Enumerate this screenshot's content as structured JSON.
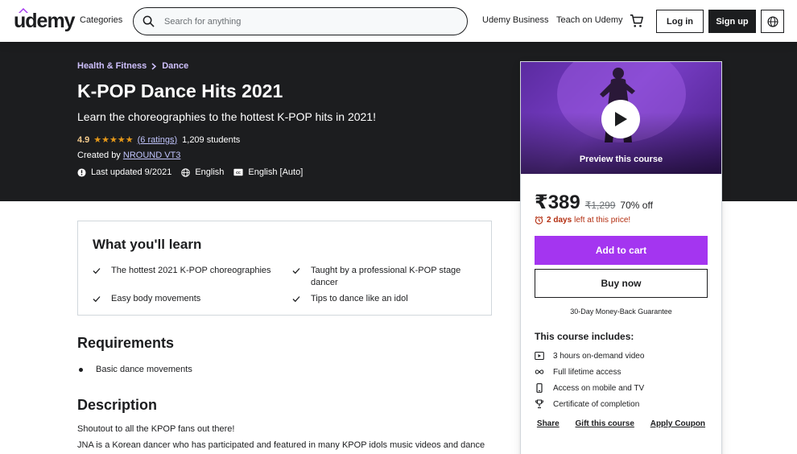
{
  "header": {
    "logo": "udemy",
    "categories": "Categories",
    "search_placeholder": "Search for anything",
    "udemy_business": "Udemy Business",
    "teach": "Teach on Udemy",
    "login": "Log in",
    "signup": "Sign up"
  },
  "course": {
    "breadcrumb": [
      "Health & Fitness",
      "Dance"
    ],
    "title": "K-POP Dance Hits 2021",
    "subtitle": "Learn the choreographies to the hottest K-POP hits in 2021!",
    "rating": "4.9",
    "ratings_count": "(6 ratings)",
    "students": "1,209 students",
    "created_by_label": "Created by",
    "instructor": "NROUND VT3",
    "last_updated": "Last updated 9/2021",
    "language": "English",
    "captions": "English [Auto]"
  },
  "learn": {
    "title": "What you'll learn",
    "items": [
      "The hottest 2021 K-POP choreographies",
      "Taught by a professional K-POP stage",
      "dancer",
      "Easy body movements",
      "Tips to dance like an idol"
    ]
  },
  "requirements": {
    "title": "Requirements",
    "items": [
      "Basic dance movements"
    ]
  },
  "description": {
    "title": "Description",
    "p1": "Shoutout to all the KPOP fans out there!",
    "p2": "JNA is a Korean dancer who has participated and featured in many KPOP idols music videos and dance"
  },
  "sidebar": {
    "preview_label": "Preview this course",
    "price": "₹389",
    "original_price": "₹1,299",
    "discount": "70% off",
    "timer_bold": "2 days",
    "timer_rest": "left at this price!",
    "add_to_cart": "Add to cart",
    "buy_now": "Buy now",
    "guarantee": "30-Day Money-Back Guarantee",
    "includes_title": "This course includes:",
    "includes": [
      "3 hours on-demand video",
      "Full lifetime access",
      "Access on mobile and TV",
      "Certificate of completion"
    ],
    "links": [
      "Share",
      "Gift this course",
      "Apply Coupon"
    ]
  },
  "colors": {
    "brand_purple": "#a435f0",
    "hero_bg": "#1c1d1f",
    "breadcrumb": "#cec0fc",
    "star": "#e59819",
    "timer": "#b32d0f"
  }
}
